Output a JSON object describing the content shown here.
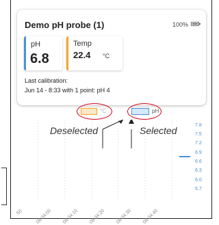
{
  "card": {
    "title": "Demo pH probe (1)",
    "battery": "100%",
    "ph": {
      "label": "pH",
      "value": "6.8",
      "color": "#4a90d9"
    },
    "temp": {
      "label": "Temp",
      "value": "22.4",
      "unit": "°C",
      "color": "#f5a623"
    },
    "calibration_line1": "Last calibration:",
    "calibration_line2": "Jun 14 - 8:33 with 1 point: pH 4"
  },
  "legend": {
    "temp_label": "°C",
    "ph_label": "pH",
    "temp_selected": false,
    "ph_selected": true
  },
  "annotations": {
    "deselected": "Deselected",
    "selected": "Selected"
  },
  "chart": {
    "y_ticks": [
      "7.8",
      "7.5",
      "7.2",
      "6.9",
      "6.6",
      "6.3",
      "6.0",
      "5.7"
    ],
    "x_ticks": [
      ":50",
      "08:34:00",
      "08:34:10",
      "08:34:20",
      "08:34:30",
      "08:34:40"
    ],
    "current_ph": 6.8
  }
}
